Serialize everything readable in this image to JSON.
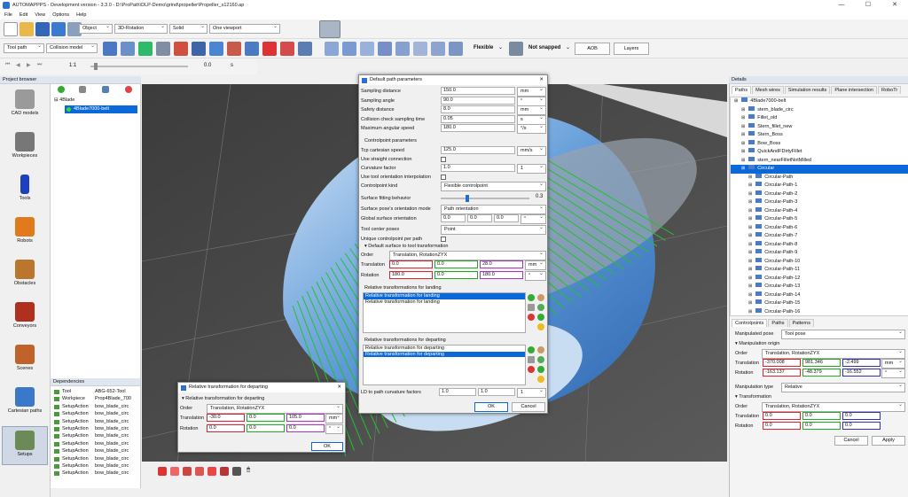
{
  "title": "AUTOMAPPPS - Development version - 3.3.0 - D:\\ProPath\\DLP-Demo\\grind\\propeller\\Propeller_s12160.ap",
  "window_controls": {
    "minimize": "—",
    "maximize": "☐",
    "close": "✕"
  },
  "menu": [
    "File",
    "Edit",
    "View",
    "Options",
    "Help"
  ],
  "toolbar1": {
    "object": "Object",
    "rotation": "3D-Rotation",
    "shading": "Solid",
    "viewport": "One viewport"
  },
  "toolbar2": {
    "toolpath": "Tool path",
    "collision": "Collision model",
    "flexible": "Flexible",
    "snap": "Not snapped",
    "aob": "AOB",
    "layers": "Layers"
  },
  "toolbar3": {
    "speed": "1:1",
    "time": "0.0",
    "unit": "s"
  },
  "project_browser": {
    "title": "Project browser",
    "nav": [
      "CAD models",
      "Workpieces",
      "Tools",
      "Robots",
      "Obstacles",
      "Conveyors",
      "Scenes",
      "Cartesian paths",
      "Setups"
    ],
    "tree": [
      "4Blade",
      "4Blade7000-belt"
    ]
  },
  "dependencies": {
    "title": "Dependencies",
    "rows": [
      [
        "Tool",
        "ABG-652-Tool"
      ],
      [
        "Workpiece",
        "Prop4Blade_700"
      ],
      [
        "SetupAction",
        "bow_blade_circ"
      ],
      [
        "SetupAction",
        "bow_blade_circ"
      ],
      [
        "SetupAction",
        "bow_blade_circ"
      ],
      [
        "SetupAction",
        "bow_blade_circ"
      ],
      [
        "SetupAction",
        "bow_blade_circ"
      ],
      [
        "SetupAction",
        "bow_blade_circ"
      ],
      [
        "SetupAction",
        "bow_blade_circ"
      ],
      [
        "SetupAction",
        "bow_blade_circ"
      ],
      [
        "SetupAction",
        "bow_blade_circ"
      ],
      [
        "SetupAction",
        "bow_blade_circ"
      ]
    ]
  },
  "details": {
    "title": "Details",
    "tabs": [
      "Paths",
      "Mesh wires",
      "Simulation results",
      "Plane intersection",
      "RoboTr"
    ],
    "tree": [
      "4Blade7000-belt",
      "stern_blade_circ",
      "Fillet_old",
      "Stern_fillet_new",
      "Stern_Boss",
      "Bow_Boss",
      "QuickAndFDirtyFillet",
      "stern_nearFilletNotMilled",
      "Circular",
      "Circular-Path",
      "Circular-Path-1",
      "Circular-Path-2",
      "Circular-Path-3",
      "Circular-Path-4",
      "Circular-Path-5",
      "Circular-Path-6",
      "Circular-Path-7",
      "Circular-Path-8",
      "Circular-Path-9",
      "Circular-Path-10",
      "Circular-Path-11",
      "Circular-Path-12",
      "Circular-Path-13",
      "Circular-Path-14",
      "Circular-Path-15",
      "Circular-Path-16"
    ],
    "bottom_tabs": [
      "Controlpoints",
      "Paths",
      "Patterns"
    ],
    "manipulated_pose_label": "Manipulated pose",
    "manipulated_pose": "Tool pose",
    "origin_label": "Manipulation origin",
    "order_label": "Order",
    "order": "Translation, RotationZYX",
    "translation_label": "Translation",
    "translation": [
      "-370.008",
      "981.346",
      "-2.499"
    ],
    "t_unit": "mm",
    "rotation_label": "Rotation",
    "rotation": [
      "-163.137",
      "-48.379",
      "-16.552"
    ],
    "r_unit": "°",
    "mtype_label": "Manipulation type",
    "mtype": "Relative",
    "transform_label": "Transformation",
    "order2": "Translation, RotationZYX",
    "translation2": [
      "0.0",
      "0.0",
      "0.0"
    ],
    "rotation2": [
      "0.0",
      "0.0",
      "0.0"
    ],
    "cancel": "Cancel",
    "apply": "Apply"
  },
  "dlg": {
    "title": "Default path parameters",
    "rows": [
      {
        "label": "Sampling distance",
        "v": "150.0",
        "u": "mm"
      },
      {
        "label": "Sampling angle",
        "v": "90.0",
        "u": "°"
      },
      {
        "label": "Safety distance",
        "v": "8.0",
        "u": "mm"
      },
      {
        "label": "Collision check sampling time",
        "v": "0.05",
        "u": "s"
      },
      {
        "label": "Maximum angular speed",
        "v": "180.0",
        "u": "°/s"
      }
    ],
    "cp_header": "Controlpoint parameters",
    "tcp_label": "Tcp cartesian speed",
    "tcp": "125.0",
    "tcp_u": "mm/s",
    "straight_label": "Use straight connection",
    "curv_label": "Curvature factor",
    "curv": "1.0",
    "curv_u": "1",
    "interp_label": "Use tool orientation interpolation",
    "cpkind_label": "Controlpoint kind",
    "cpkind": "Flexible controlpoint",
    "sfb_label": "Surface fitting behavior",
    "sfb": "0.3",
    "spo_label": "Surface pose's orientation mode",
    "spo": "Path orientation",
    "gso_label": "Global surface orientation",
    "gso": [
      "0.0",
      "0.0",
      "0.0"
    ],
    "gso_u": "°",
    "tcp_poses_label": "Tool center poses",
    "tcp_poses": "Point",
    "unique_label": "Unique controlpoint per path",
    "dst_label": "Default surface to tool transformation",
    "order_label": "Order",
    "order": "Translation, RotationZYX",
    "translation_label": "Translation",
    "translation": [
      "0.0",
      "0.0",
      "28.0"
    ],
    "t_u": "mm",
    "rotation_label": "Rotation",
    "rotation": [
      "180.0",
      "0.0",
      "180.0"
    ],
    "r_u": "°",
    "landing_label": "Relative transformations for landing",
    "landing": [
      "Relative transformation for landing",
      "Relative transformation for landing"
    ],
    "departing_label": "Relative transformations for departing",
    "departing": [
      "Relative transformation for departing",
      "Relative transformation for departing"
    ],
    "ld_label": "LD to path curvature factors",
    "ld": [
      "1.0",
      "1.0"
    ],
    "ld_u": "1",
    "ok": "OK",
    "cancel": "Cancel"
  },
  "dlg2": {
    "title": "Relative transformation for departing",
    "sub": "Relative transformation for departing",
    "order_label": "Order",
    "order": "Translation, RotationZYX",
    "translation_label": "Translation",
    "translation": [
      "-30.0",
      "0.0",
      "105.0"
    ],
    "t_u": "mm",
    "rotation_label": "Rotation",
    "rotation": [
      "0.0",
      "0.0",
      "0.0"
    ],
    "r_u": "°",
    "ok": "OK"
  },
  "colors": {
    "accent": "#0a68d8",
    "blade": "#5e99d8",
    "path": "#22c22a"
  }
}
